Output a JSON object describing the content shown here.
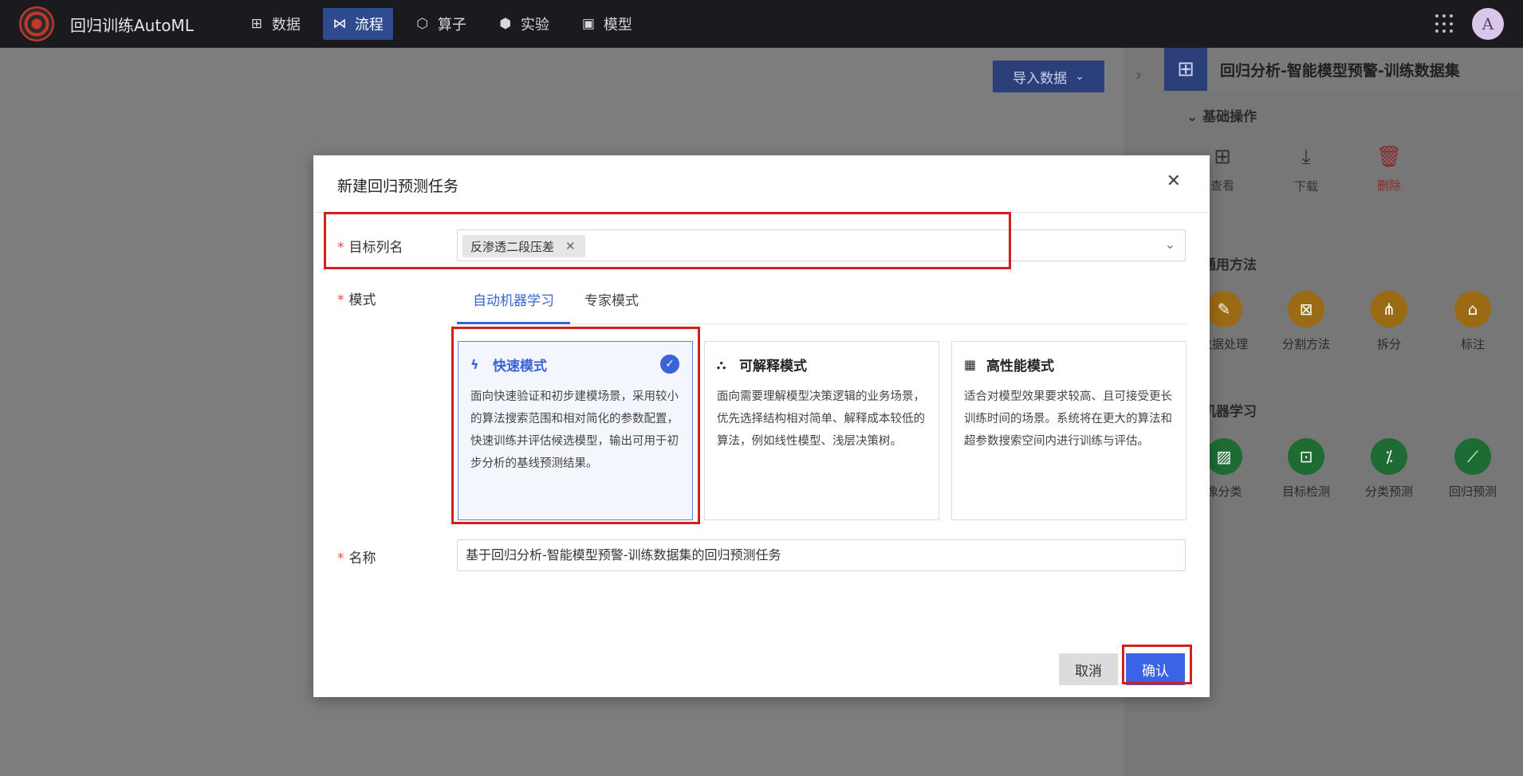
{
  "app": {
    "brand": "回归训练AutoML",
    "avatar": "A"
  },
  "nav": [
    {
      "icon": "⊞",
      "label": "数据"
    },
    {
      "icon": "⋈",
      "label": "流程"
    },
    {
      "icon": "⬡",
      "label": "算子"
    },
    {
      "icon": "⬢",
      "label": "实验"
    },
    {
      "icon": "▣",
      "label": "模型"
    }
  ],
  "canvas": {
    "import_label": "导入数据"
  },
  "panel": {
    "title": "回归分析-智能模型预警-训练数据集",
    "basic": {
      "title": "基础操作",
      "ops": [
        "查看",
        "下载",
        "删除"
      ]
    },
    "common": {
      "title": "通用方法",
      "items": [
        "数据处理",
        "分割方法",
        "拆分",
        "标注"
      ]
    },
    "ml": {
      "title": "机器学习",
      "items": [
        "像分类",
        "目标检测",
        "分类预测",
        "回归预测"
      ]
    }
  },
  "modal": {
    "title": "新建回归预测任务",
    "target_label": "目标列名",
    "target_tag": "反渗透二段压差",
    "mode_label": "模式",
    "tabs": [
      "自动机器学习",
      "专家模式"
    ],
    "cards": [
      {
        "title": "快速模式",
        "desc": "面向快速验证和初步建模场景，采用较小的算法搜索范围和相对简化的参数配置，快速训练并评估候选模型，输出可用于初步分析的基线预测结果。"
      },
      {
        "title": "可解释模式",
        "desc": "面向需要理解模型决策逻辑的业务场景，优先选择结构相对简单、解释成本较低的算法，例如线性模型、浅层决策树。"
      },
      {
        "title": "高性能模式",
        "desc": "适合对模型效果要求较高、且可接受更长训练时间的场景。系统将在更大的算法和超参数搜索空间内进行训练与评估。"
      }
    ],
    "name_label": "名称",
    "name_value": "基于回归分析-智能模型预警-训练数据集的回归预测任务",
    "cancel": "取消",
    "confirm": "确认"
  }
}
